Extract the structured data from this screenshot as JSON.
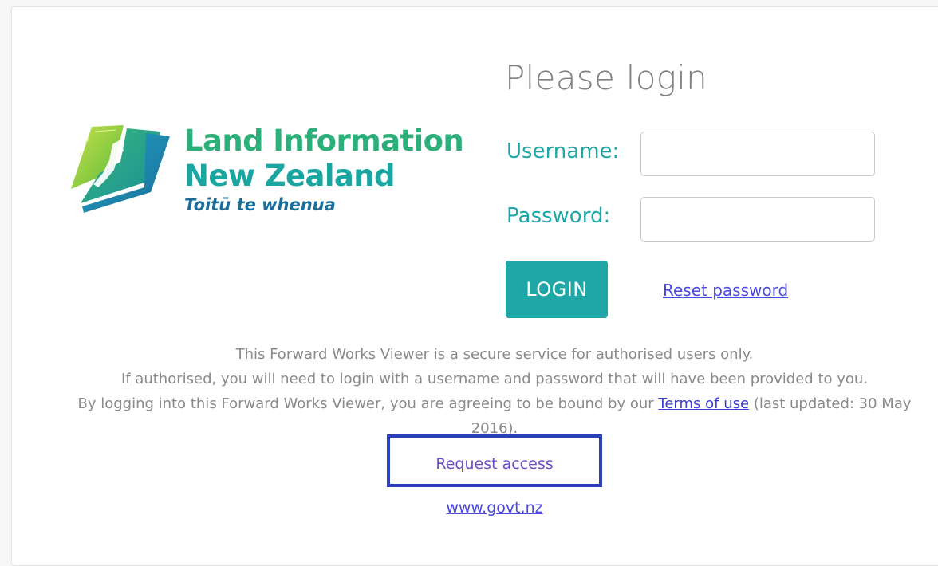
{
  "brand": {
    "name_line1": "Land Information",
    "name_line2": "New Zealand",
    "tagline": "Toitū te whenua",
    "colors": {
      "green": "#2bb07a",
      "teal": "#1aa6a0",
      "blue": "#1b6e9a"
    }
  },
  "login": {
    "title": "Please login",
    "username_label": "Username:",
    "username_value": "",
    "password_label": "Password:",
    "password_value": "",
    "submit_label": "LOGIN",
    "reset_label": "Reset password",
    "accent_color": "#1fa6a6"
  },
  "notice": {
    "line1": "This Forward Works Viewer is a secure service for authorised users only.",
    "line2": "If authorised, you will need to login with a username and password that will have been provided to you.",
    "line3_prefix": "By logging into this Forward Works Viewer, you are agreeing to be bound by our",
    "terms_label": "Terms of use",
    "line3_suffix": "(last updated: 30 May 2016)."
  },
  "links": {
    "request_access": "Request access",
    "govt": "www.govt.nz"
  }
}
